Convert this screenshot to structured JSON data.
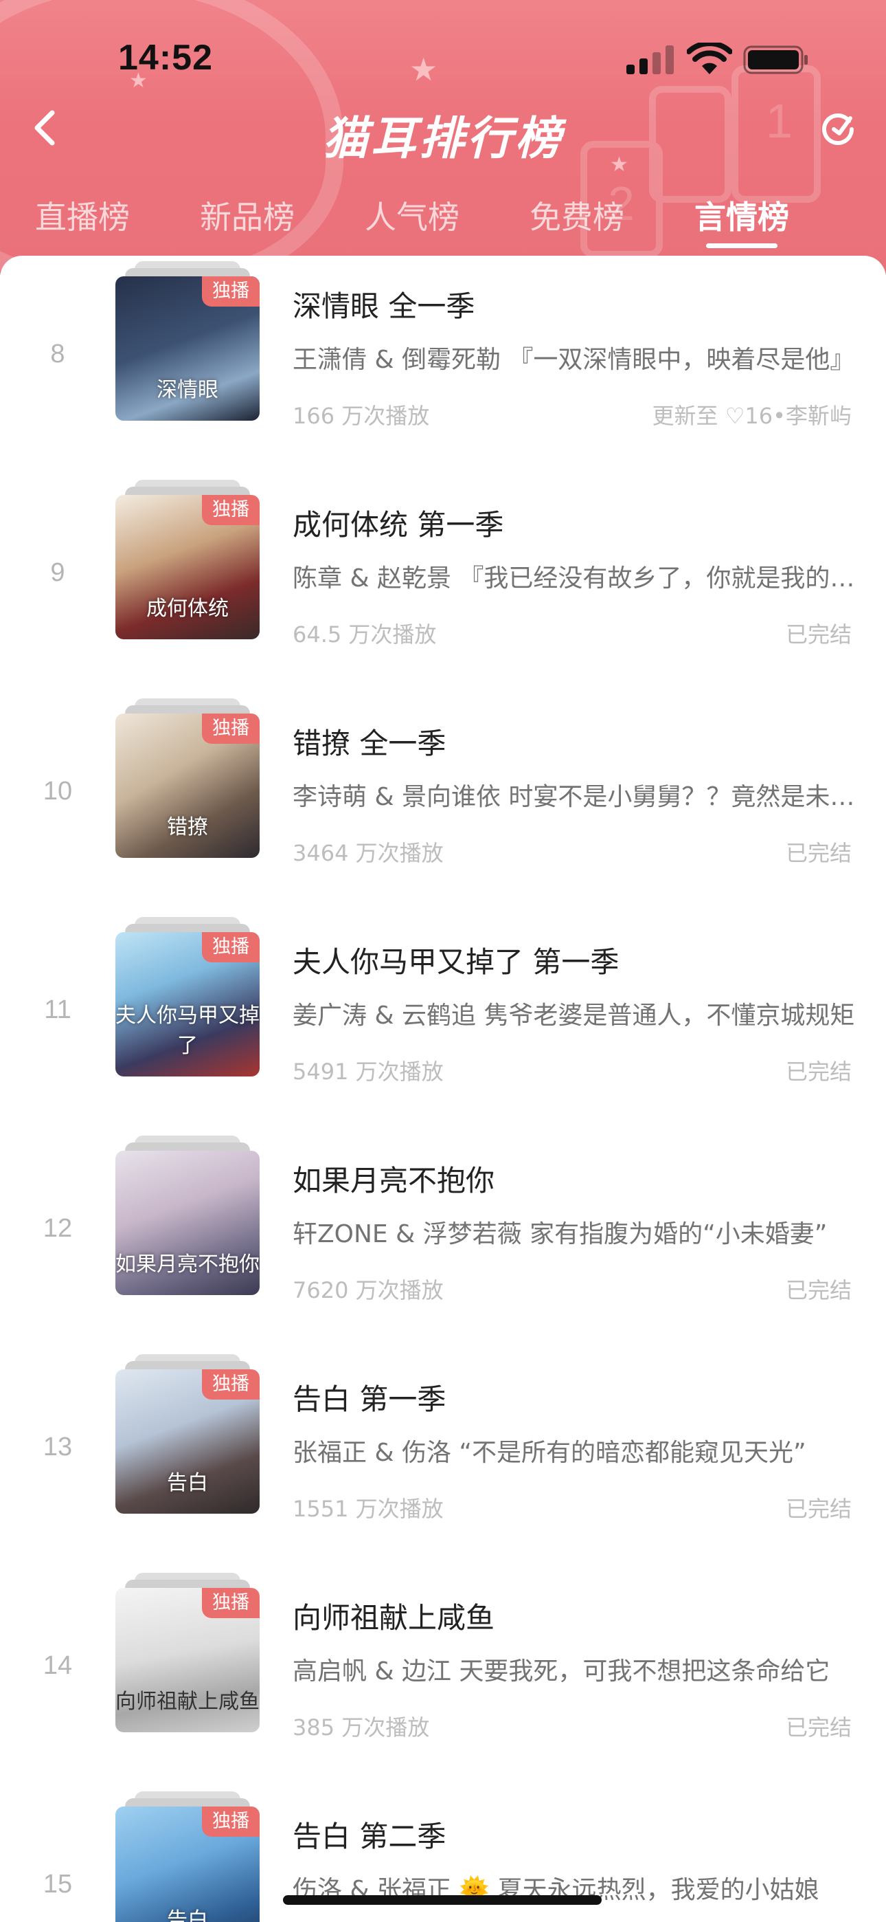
{
  "status_bar": {
    "time": "14:52"
  },
  "header": {
    "title": "猫耳排行榜",
    "tabs": [
      {
        "label": "直播榜",
        "active": false
      },
      {
        "label": "新品榜",
        "active": false
      },
      {
        "label": "人气榜",
        "active": false
      },
      {
        "label": "免费榜",
        "active": false
      },
      {
        "label": "言情榜",
        "active": true
      }
    ]
  },
  "list": {
    "items": [
      {
        "rank": "8",
        "title": "深情眼 全一季",
        "cover_text": "深情眼",
        "badge": "独播",
        "desc": "王潇倩 & 倒霉死勒 『一双深情眼中，映着尽是他』",
        "plays": "166 万次播放",
        "status": "更新至 ♡16•李靳屿"
      },
      {
        "rank": "9",
        "title": "成何体统 第一季",
        "cover_text": "成何体统",
        "badge": "独播",
        "desc": "陈章 & 赵乾景 『我已经没有故乡了，你就是我的故乡』",
        "plays": "64.5 万次播放",
        "status": "已完结"
      },
      {
        "rank": "10",
        "title": "错撩 全一季",
        "cover_text": "错撩",
        "badge": "独播",
        "desc": "李诗萌 & 景向谁依 时宴不是小舅舅？？竟然是未婚夫",
        "plays": "3464 万次播放",
        "status": "已完结"
      },
      {
        "rank": "11",
        "title": "夫人你马甲又掉了 第一季",
        "cover_text": "夫人你马甲又掉了",
        "badge": "独播",
        "desc": "姜广涛 & 云鹤追 隽爷老婆是普通人，不懂京城规矩",
        "plays": "5491 万次播放",
        "status": "已完结"
      },
      {
        "rank": "12",
        "title": "如果月亮不抱你",
        "cover_text": "如果月亮不抱你",
        "badge": "",
        "desc": "轩ZONE & 浮梦若薇 家有指腹为婚的“小未婚妻”",
        "plays": "7620 万次播放",
        "status": "已完结"
      },
      {
        "rank": "13",
        "title": "告白 第一季",
        "cover_text": "告白",
        "badge": "独播",
        "desc": "张福正 & 伤洛 “不是所有的暗恋都能窥见天光”",
        "plays": "1551 万次播放",
        "status": "已完结"
      },
      {
        "rank": "14",
        "title": "向师祖献上咸鱼",
        "cover_text": "向师祖献上咸鱼",
        "badge": "独播",
        "desc": "高启帆 & 边江 天要我死，可我不想把这条命给它",
        "plays": "385 万次播放",
        "status": "已完结"
      },
      {
        "rank": "15",
        "title": "告白 第二季",
        "cover_text": "告白",
        "badge": "独播",
        "desc": "伤洛 & 张福正 🌞 夏天永远热烈，我爱的小姑娘",
        "plays": "",
        "status": ""
      }
    ]
  },
  "colors": {
    "header": "#ec737c",
    "badge": "#ea6f6c",
    "rank": "#b5b5b5"
  },
  "icons": [
    "back-arrow-icon",
    "refresh-icon",
    "signal-icon",
    "wifi-icon",
    "battery-icon"
  ]
}
